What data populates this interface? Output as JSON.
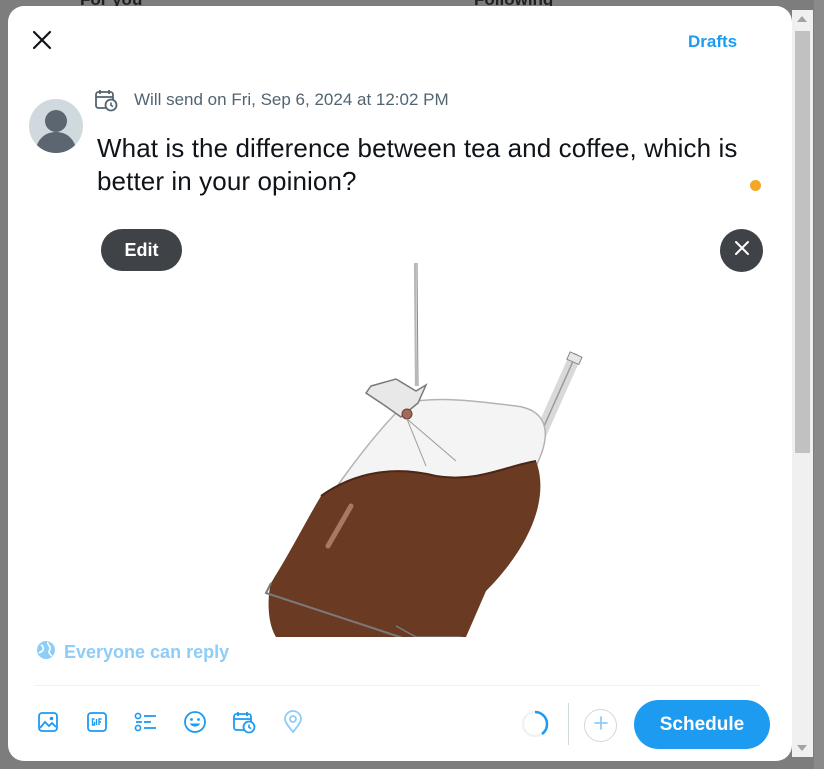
{
  "background": {
    "tabs": [
      "For you",
      "Following"
    ]
  },
  "modal": {
    "drafts_label": "Drafts",
    "schedule_text": "Will send on Fri, Sep 6, 2024 at 12:02 PM",
    "post_text": "What is the difference between tea and coffee, which is better in your opinion?",
    "media": {
      "edit_label": "Edit"
    },
    "reply_setting": "Everyone can reply",
    "schedule_button": "Schedule"
  },
  "colors": {
    "accent": "#1d9bf0",
    "reply_setting": "#8ecdf7",
    "muted_text": "#536471",
    "char_dot": "#f5a623"
  },
  "toolbar_icons": [
    "image-icon",
    "gif-icon",
    "poll-icon",
    "emoji-icon",
    "schedule-icon",
    "location-icon"
  ]
}
